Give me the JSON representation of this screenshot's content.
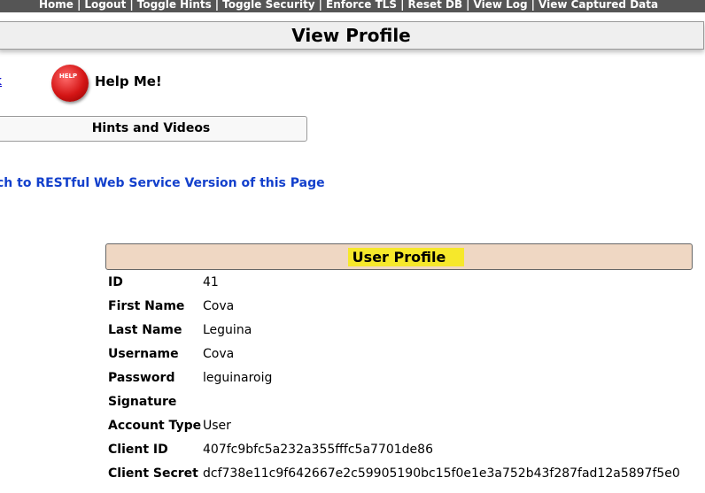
{
  "nav": {
    "items": [
      "Home",
      "Logout",
      "Toggle Hints",
      "Toggle Security",
      "Enforce TLS",
      "Reset DB",
      "View Log",
      "View Captured Data"
    ],
    "separator": "|"
  },
  "page": {
    "title": "View Profile"
  },
  "back_link": "k",
  "help": {
    "icon_text": "HELP",
    "label": "Help Me!"
  },
  "hints": {
    "label": "Hints and Videos"
  },
  "rest_link": "ch to RESTful Web Service Version of this Page",
  "profile": {
    "header": "User Profile",
    "fields": [
      {
        "label": "ID",
        "value": "41"
      },
      {
        "label": "First Name",
        "value": "Cova"
      },
      {
        "label": "Last Name",
        "value": "Leguina"
      },
      {
        "label": "Username",
        "value": "Cova"
      },
      {
        "label": "Password",
        "value": "leguinaroig"
      },
      {
        "label": "Signature",
        "value": ""
      },
      {
        "label": "Account Type",
        "value": "User"
      },
      {
        "label": "Client ID",
        "value": "407fc9bfc5a232a355fffc5a7701de86"
      },
      {
        "label": "Client Secret",
        "value": "dcf738e11c9f642667e2c59905190bc15f0e1e3a752b43f287fad12a5897f5e0"
      }
    ]
  },
  "colors": {
    "nav_bg": "#555555",
    "profile_header_bg": "#efd7c3",
    "highlight": "#f6e82b",
    "link": "#1340cc"
  }
}
